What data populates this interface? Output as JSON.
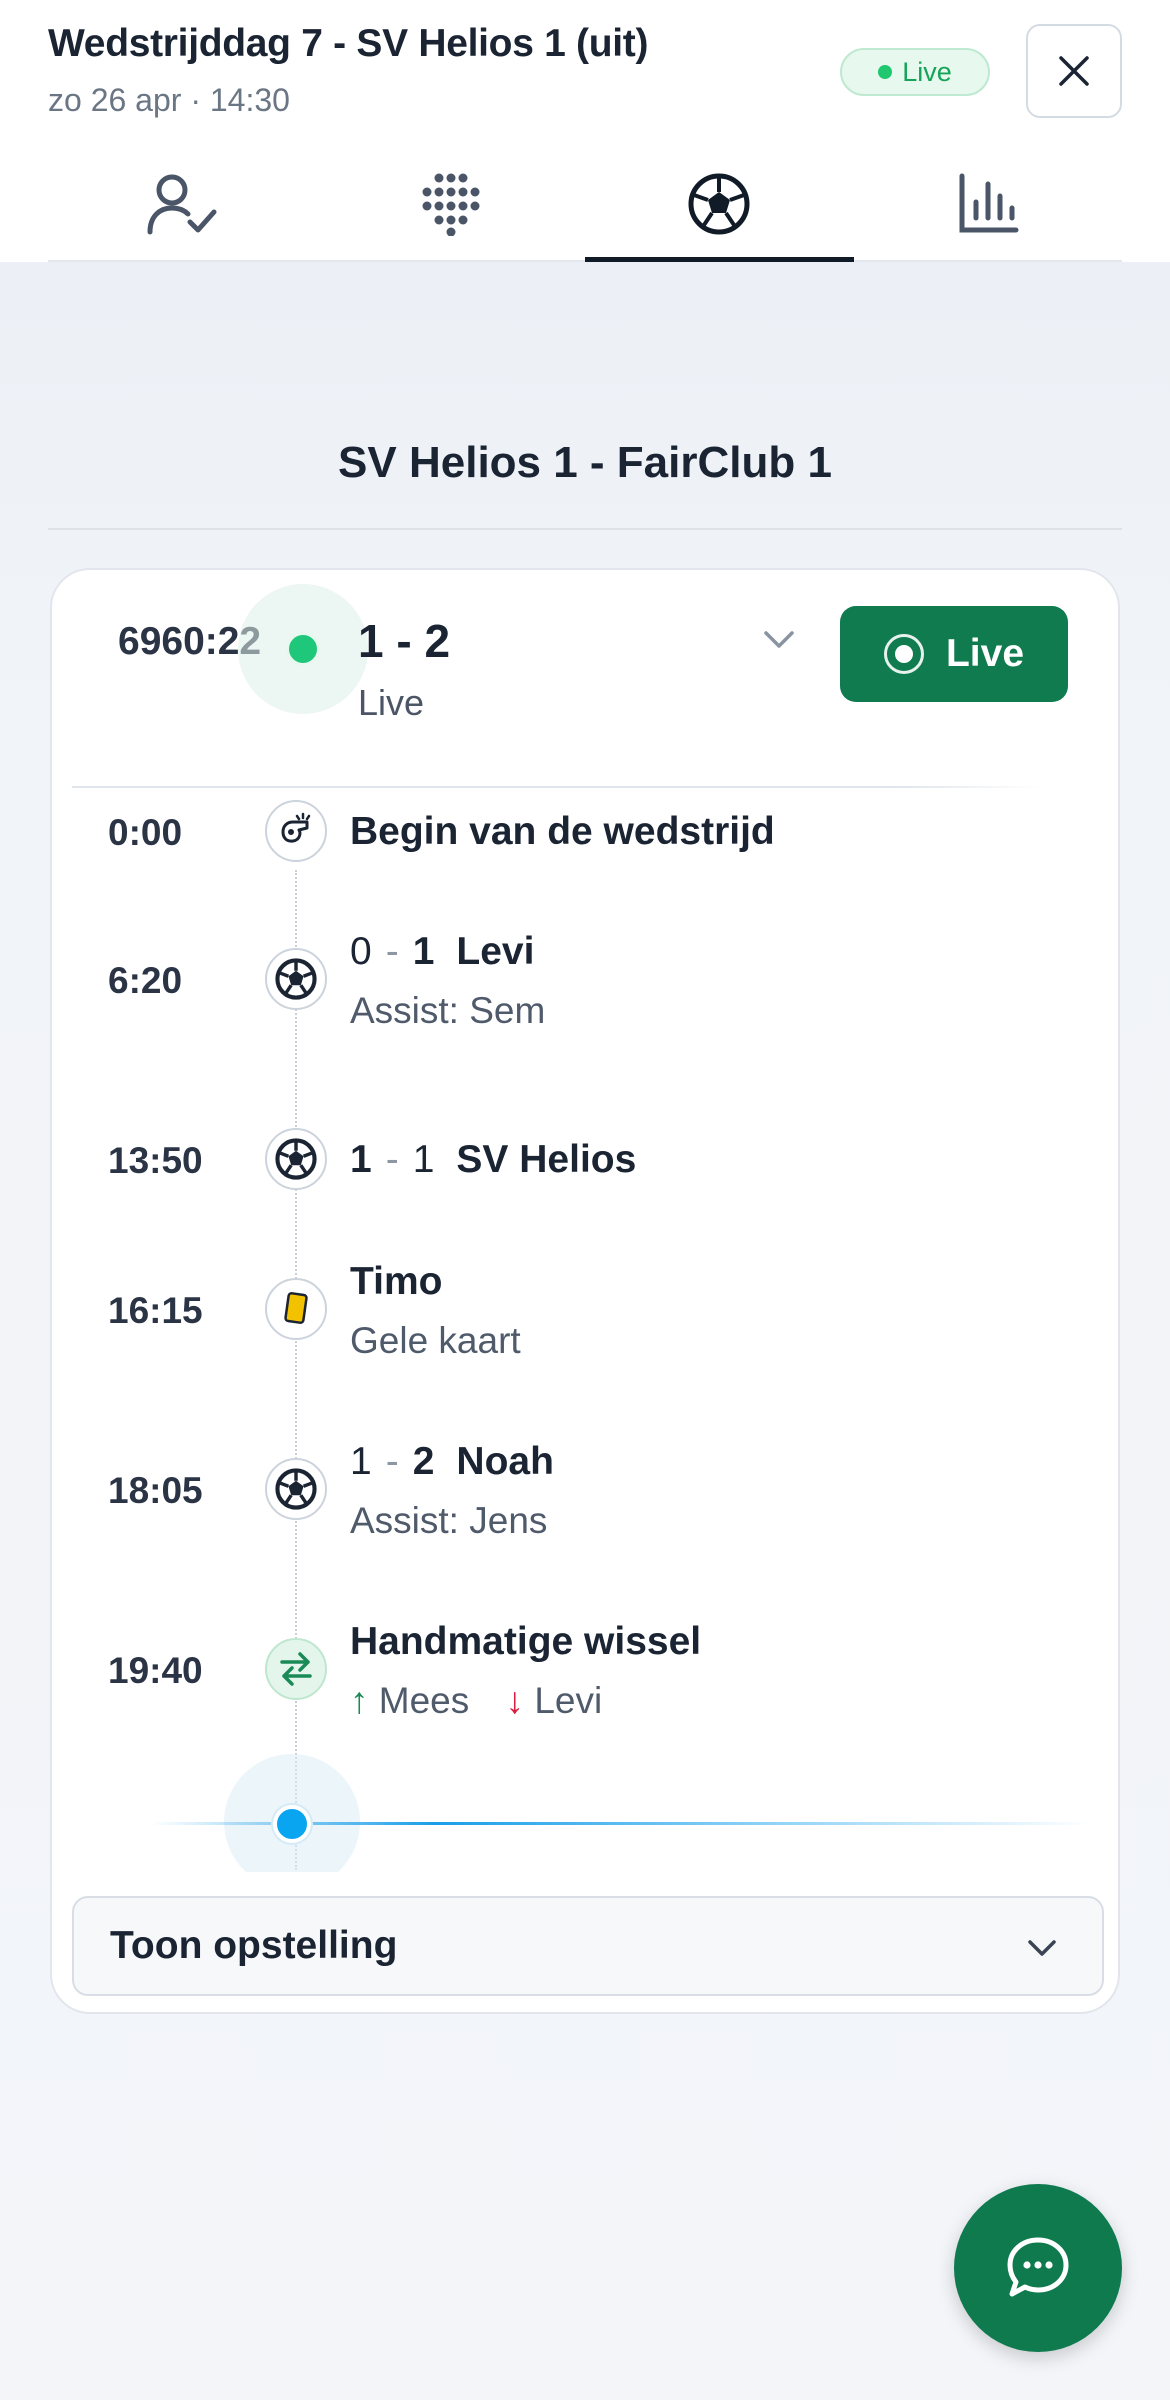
{
  "header": {
    "title": "Wedstrijddag 7 - SV Helios 1 (uit)",
    "subtitle": "zo 26 apr · 14:30",
    "status_pill": "Live"
  },
  "tabs": [
    {
      "icon": "user-check-icon",
      "active": false
    },
    {
      "icon": "formation-dots-icon",
      "active": false
    },
    {
      "icon": "soccer-ball-icon",
      "active": true
    },
    {
      "icon": "bar-chart-icon",
      "active": false
    }
  ],
  "match": {
    "teams": "SV Helios 1 - FairClub 1",
    "clock": "6960:22",
    "score": "1 - 2",
    "status": "Live",
    "live_button": "Live"
  },
  "events": [
    {
      "time": "0:00",
      "type": "whistle",
      "title": "Begin van de wedstrijd"
    },
    {
      "time": "6:20",
      "type": "goal",
      "score_left": "0",
      "score_right": "1",
      "bold_side": "right",
      "player": "Levi",
      "detail": "Assist: Sem"
    },
    {
      "time": "13:50",
      "type": "goal",
      "score_left": "1",
      "score_right": "1",
      "bold_side": "left",
      "player": "SV Helios"
    },
    {
      "time": "16:15",
      "type": "yellow-card",
      "title": "Timo",
      "detail": "Gele kaart"
    },
    {
      "time": "18:05",
      "type": "goal",
      "score_left": "1",
      "score_right": "2",
      "bold_side": "right",
      "player": "Noah",
      "detail": "Assist: Jens"
    },
    {
      "time": "19:40",
      "type": "substitution",
      "title": "Handmatige wissel",
      "player_in": "Mees",
      "player_out": "Levi"
    }
  ],
  "lineup": {
    "label": "Toon opstelling"
  },
  "colors": {
    "accent_green": "#0f7b4f",
    "live_green": "#1ec77a",
    "yellow_card": "#f2c200",
    "arrow_in": "#1a8a56",
    "arrow_out": "#d81e3f",
    "progress_blue": "#0aa5f0"
  },
  "fab": {
    "icon": "chat-bubble-icon"
  }
}
